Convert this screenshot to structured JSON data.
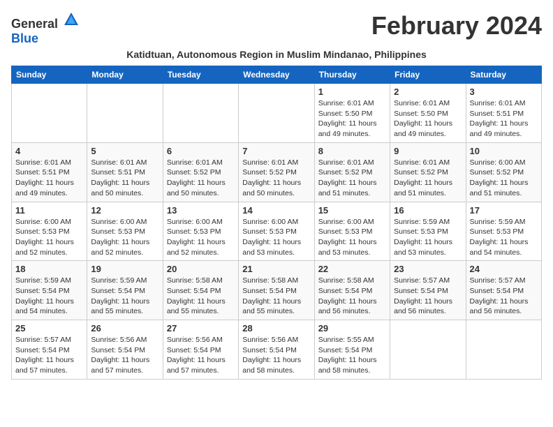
{
  "header": {
    "logo_general": "General",
    "logo_blue": "Blue",
    "month_title": "February 2024",
    "subtitle": "Katidtuan, Autonomous Region in Muslim Mindanao, Philippines"
  },
  "days_of_week": [
    "Sunday",
    "Monday",
    "Tuesday",
    "Wednesday",
    "Thursday",
    "Friday",
    "Saturday"
  ],
  "weeks": [
    [
      {
        "day": "",
        "sunrise": "",
        "sunset": "",
        "daylight": ""
      },
      {
        "day": "",
        "sunrise": "",
        "sunset": "",
        "daylight": ""
      },
      {
        "day": "",
        "sunrise": "",
        "sunset": "",
        "daylight": ""
      },
      {
        "day": "",
        "sunrise": "",
        "sunset": "",
        "daylight": ""
      },
      {
        "day": "1",
        "sunrise": "Sunrise: 6:01 AM",
        "sunset": "Sunset: 5:50 PM",
        "daylight": "Daylight: 11 hours and 49 minutes."
      },
      {
        "day": "2",
        "sunrise": "Sunrise: 6:01 AM",
        "sunset": "Sunset: 5:50 PM",
        "daylight": "Daylight: 11 hours and 49 minutes."
      },
      {
        "day": "3",
        "sunrise": "Sunrise: 6:01 AM",
        "sunset": "Sunset: 5:51 PM",
        "daylight": "Daylight: 11 hours and 49 minutes."
      }
    ],
    [
      {
        "day": "4",
        "sunrise": "Sunrise: 6:01 AM",
        "sunset": "Sunset: 5:51 PM",
        "daylight": "Daylight: 11 hours and 49 minutes."
      },
      {
        "day": "5",
        "sunrise": "Sunrise: 6:01 AM",
        "sunset": "Sunset: 5:51 PM",
        "daylight": "Daylight: 11 hours and 50 minutes."
      },
      {
        "day": "6",
        "sunrise": "Sunrise: 6:01 AM",
        "sunset": "Sunset: 5:52 PM",
        "daylight": "Daylight: 11 hours and 50 minutes."
      },
      {
        "day": "7",
        "sunrise": "Sunrise: 6:01 AM",
        "sunset": "Sunset: 5:52 PM",
        "daylight": "Daylight: 11 hours and 50 minutes."
      },
      {
        "day": "8",
        "sunrise": "Sunrise: 6:01 AM",
        "sunset": "Sunset: 5:52 PM",
        "daylight": "Daylight: 11 hours and 51 minutes."
      },
      {
        "day": "9",
        "sunrise": "Sunrise: 6:01 AM",
        "sunset": "Sunset: 5:52 PM",
        "daylight": "Daylight: 11 hours and 51 minutes."
      },
      {
        "day": "10",
        "sunrise": "Sunrise: 6:00 AM",
        "sunset": "Sunset: 5:52 PM",
        "daylight": "Daylight: 11 hours and 51 minutes."
      }
    ],
    [
      {
        "day": "11",
        "sunrise": "Sunrise: 6:00 AM",
        "sunset": "Sunset: 5:53 PM",
        "daylight": "Daylight: 11 hours and 52 minutes."
      },
      {
        "day": "12",
        "sunrise": "Sunrise: 6:00 AM",
        "sunset": "Sunset: 5:53 PM",
        "daylight": "Daylight: 11 hours and 52 minutes."
      },
      {
        "day": "13",
        "sunrise": "Sunrise: 6:00 AM",
        "sunset": "Sunset: 5:53 PM",
        "daylight": "Daylight: 11 hours and 52 minutes."
      },
      {
        "day": "14",
        "sunrise": "Sunrise: 6:00 AM",
        "sunset": "Sunset: 5:53 PM",
        "daylight": "Daylight: 11 hours and 53 minutes."
      },
      {
        "day": "15",
        "sunrise": "Sunrise: 6:00 AM",
        "sunset": "Sunset: 5:53 PM",
        "daylight": "Daylight: 11 hours and 53 minutes."
      },
      {
        "day": "16",
        "sunrise": "Sunrise: 5:59 AM",
        "sunset": "Sunset: 5:53 PM",
        "daylight": "Daylight: 11 hours and 53 minutes."
      },
      {
        "day": "17",
        "sunrise": "Sunrise: 5:59 AM",
        "sunset": "Sunset: 5:53 PM",
        "daylight": "Daylight: 11 hours and 54 minutes."
      }
    ],
    [
      {
        "day": "18",
        "sunrise": "Sunrise: 5:59 AM",
        "sunset": "Sunset: 5:54 PM",
        "daylight": "Daylight: 11 hours and 54 minutes."
      },
      {
        "day": "19",
        "sunrise": "Sunrise: 5:59 AM",
        "sunset": "Sunset: 5:54 PM",
        "daylight": "Daylight: 11 hours and 55 minutes."
      },
      {
        "day": "20",
        "sunrise": "Sunrise: 5:58 AM",
        "sunset": "Sunset: 5:54 PM",
        "daylight": "Daylight: 11 hours and 55 minutes."
      },
      {
        "day": "21",
        "sunrise": "Sunrise: 5:58 AM",
        "sunset": "Sunset: 5:54 PM",
        "daylight": "Daylight: 11 hours and 55 minutes."
      },
      {
        "day": "22",
        "sunrise": "Sunrise: 5:58 AM",
        "sunset": "Sunset: 5:54 PM",
        "daylight": "Daylight: 11 hours and 56 minutes."
      },
      {
        "day": "23",
        "sunrise": "Sunrise: 5:57 AM",
        "sunset": "Sunset: 5:54 PM",
        "daylight": "Daylight: 11 hours and 56 minutes."
      },
      {
        "day": "24",
        "sunrise": "Sunrise: 5:57 AM",
        "sunset": "Sunset: 5:54 PM",
        "daylight": "Daylight: 11 hours and 56 minutes."
      }
    ],
    [
      {
        "day": "25",
        "sunrise": "Sunrise: 5:57 AM",
        "sunset": "Sunset: 5:54 PM",
        "daylight": "Daylight: 11 hours and 57 minutes."
      },
      {
        "day": "26",
        "sunrise": "Sunrise: 5:56 AM",
        "sunset": "Sunset: 5:54 PM",
        "daylight": "Daylight: 11 hours and 57 minutes."
      },
      {
        "day": "27",
        "sunrise": "Sunrise: 5:56 AM",
        "sunset": "Sunset: 5:54 PM",
        "daylight": "Daylight: 11 hours and 57 minutes."
      },
      {
        "day": "28",
        "sunrise": "Sunrise: 5:56 AM",
        "sunset": "Sunset: 5:54 PM",
        "daylight": "Daylight: 11 hours and 58 minutes."
      },
      {
        "day": "29",
        "sunrise": "Sunrise: 5:55 AM",
        "sunset": "Sunset: 5:54 PM",
        "daylight": "Daylight: 11 hours and 58 minutes."
      },
      {
        "day": "",
        "sunrise": "",
        "sunset": "",
        "daylight": ""
      },
      {
        "day": "",
        "sunrise": "",
        "sunset": "",
        "daylight": ""
      }
    ]
  ]
}
